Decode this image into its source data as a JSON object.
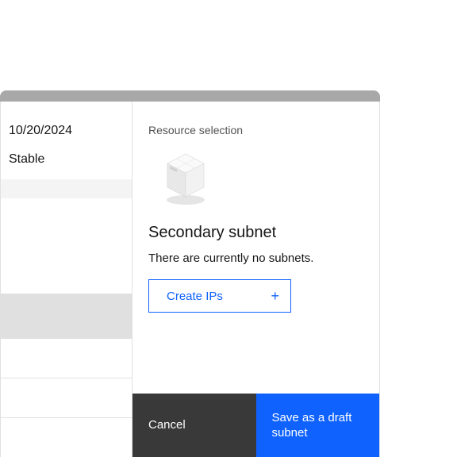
{
  "left": {
    "date": "10/20/2024",
    "status": "Stable"
  },
  "panel": {
    "section_label": "Resource selection",
    "subhead": "Secondary subnet",
    "empty_text": "There are currently no subnets.",
    "create_label": "Create IPs"
  },
  "footer": {
    "cancel": "Cancel",
    "save": "Save as a draft subnet"
  },
  "icons": {
    "plus": "+"
  }
}
